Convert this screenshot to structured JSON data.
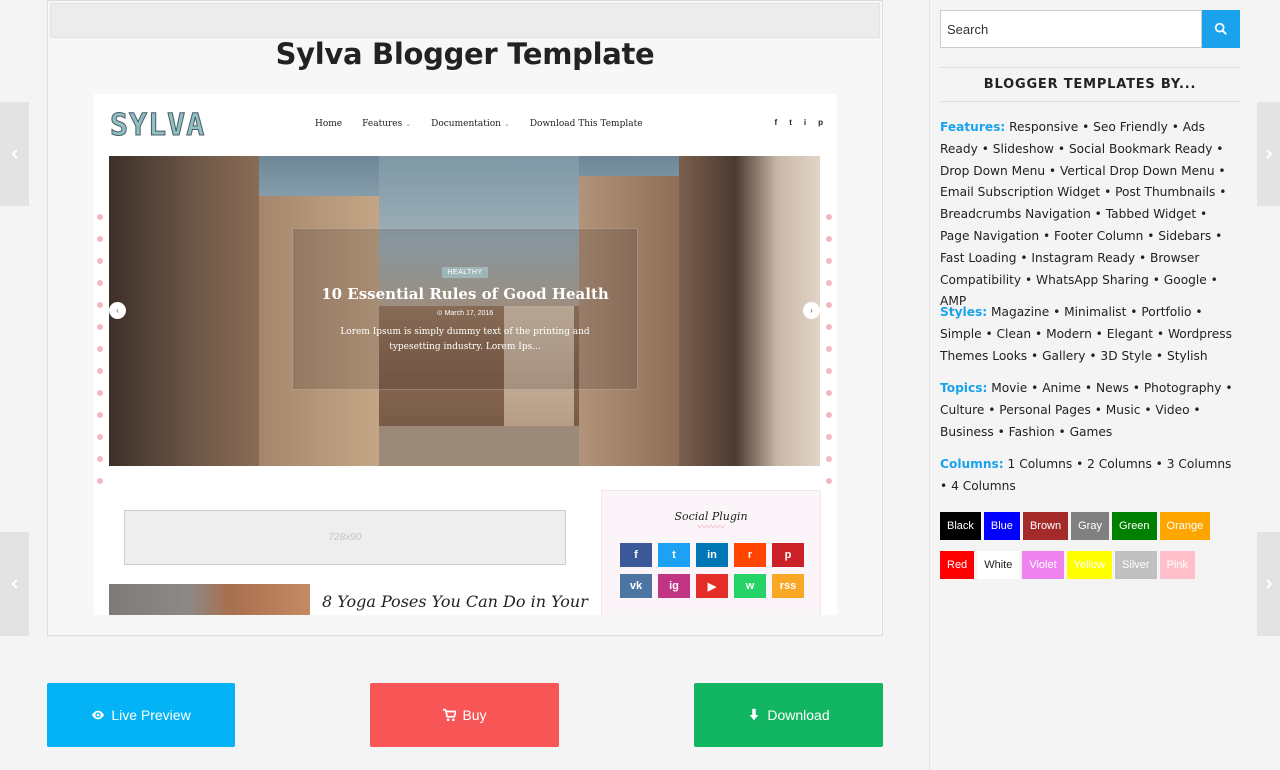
{
  "page": {
    "title": "Sylva Blogger Template"
  },
  "preview": {
    "logo": "SYLVA",
    "nav": [
      {
        "label": "Home",
        "caret": false
      },
      {
        "label": "Features",
        "caret": true
      },
      {
        "label": "Documentation",
        "caret": true
      },
      {
        "label": "Download This Template",
        "caret": false
      }
    ],
    "social_icons": [
      "f",
      "t",
      "i",
      "p"
    ],
    "slide": {
      "tag": "HEALTHY",
      "title": "10 Essential Rules of Good Health",
      "date": "⊙ March 17, 2016",
      "description": "Lorem Ipsum is simply dummy text of the printing and typesetting industry. Lorem Ips..."
    },
    "ad_label": "728x90",
    "post_title": "8 Yoga Poses You Can Do in Your",
    "social_widget": {
      "title": "Social Plugin",
      "wave": "〰〰〰",
      "buttons": [
        {
          "glyph": "f",
          "color": "#3b5998",
          "name": "facebook-icon"
        },
        {
          "glyph": "t",
          "color": "#1da1f2",
          "name": "twitter-icon"
        },
        {
          "glyph": "in",
          "color": "#0077b5",
          "name": "linkedin-icon"
        },
        {
          "glyph": "r",
          "color": "#ff4500",
          "name": "reddit-icon"
        },
        {
          "glyph": "p",
          "color": "#cb2027",
          "name": "pinterest-icon"
        },
        {
          "glyph": "vk",
          "color": "#4c75a3",
          "name": "vk-icon"
        },
        {
          "glyph": "ig",
          "color": "#c13584",
          "name": "instagram-icon"
        },
        {
          "glyph": "▶",
          "color": "#e52d27",
          "name": "youtube-icon"
        },
        {
          "glyph": "w",
          "color": "#25d366",
          "name": "whatsapp-icon"
        },
        {
          "glyph": "rss",
          "color": "#f9a825",
          "name": "rss-icon"
        }
      ]
    }
  },
  "buttons": {
    "live_preview": {
      "label": "Live Preview",
      "color": "#03b3f6"
    },
    "buy": {
      "label": "Buy",
      "color": "#f85656"
    },
    "download": {
      "label": "Download",
      "color": "#12b561"
    }
  },
  "sidebar": {
    "search_placeholder": "Search",
    "heading": "BLOGGER TEMPLATES BY...",
    "sections": [
      {
        "key": "Features:",
        "text": " Responsive • Seo Friendly • Ads Ready • Slideshow • Social Bookmark Ready • Drop Down Menu • Vertical Drop Down Menu • Email Subscription Widget • Post Thumbnails • Breadcrumbs Navigation • Tabbed Widget • Page Navigation • Footer Column • Sidebars • Fast Loading • Instagram Ready • Browser Compatibility • WhatsApp Sharing • Google • AMP"
      },
      {
        "key": "Styles:",
        "text": " Magazine • Minimalist • Portfolio • Simple • Clean • Modern • Elegant • Wordpress Themes Looks • Gallery • 3D Style • Stylish"
      },
      {
        "key": "Topics:",
        "text": " Movie • Anime • News • Photography • Culture • Personal Pages • Music • Video • Business • Fashion • Games"
      },
      {
        "key": "Columns:",
        "text": " 1 Columns • 2 Columns • 3 Columns • 4 Columns"
      }
    ],
    "colors_row1": [
      {
        "label": "Black",
        "bg": "#000000",
        "fg": "#ffffff"
      },
      {
        "label": "Blue",
        "bg": "#0000ff",
        "fg": "#ffffff"
      },
      {
        "label": "Brown",
        "bg": "#a52a2a",
        "fg": "#ffffff"
      },
      {
        "label": "Gray",
        "bg": "#808080",
        "fg": "#ffffff"
      },
      {
        "label": "Green",
        "bg": "#008000",
        "fg": "#ffffff"
      },
      {
        "label": "Orange",
        "bg": "#ffa500",
        "fg": "#ffffff"
      }
    ],
    "colors_row2": [
      {
        "label": "Red",
        "bg": "#ff0000",
        "fg": "#ffffff"
      },
      {
        "label": "White",
        "bg": "#ffffff",
        "fg": "#222222"
      },
      {
        "label": "Violet",
        "bg": "#ee82ee",
        "fg": "#ffffff"
      },
      {
        "label": "Yellow",
        "bg": "#ffff00",
        "fg": "#ffffff"
      },
      {
        "label": "Silver",
        "bg": "#c0c0c0",
        "fg": "#ffffff"
      },
      {
        "label": "Pink",
        "bg": "#ffc0cb",
        "fg": "#ffffff"
      }
    ]
  }
}
